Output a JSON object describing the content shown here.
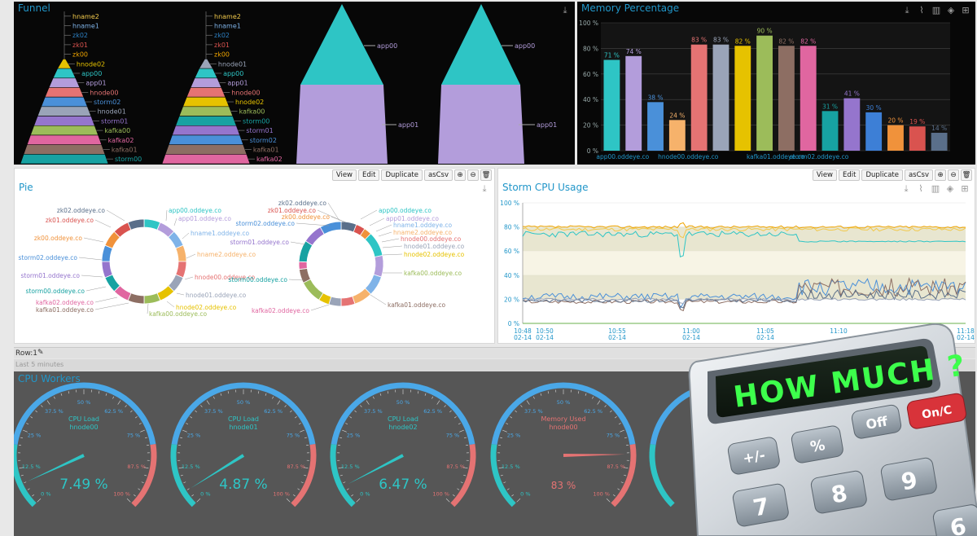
{
  "funnel_panel": {
    "title": "Funnel",
    "funnel_left": {
      "items": [
        {
          "label": "hname2",
          "color": "#f2c94c"
        },
        {
          "label": "hname1",
          "color": "#7fb3e8"
        },
        {
          "label": "zk02",
          "color": "#2d7fc1"
        },
        {
          "label": "zk01",
          "color": "#d9534f"
        },
        {
          "label": "zk00",
          "color": "#f0a500"
        },
        {
          "label": "hnode02",
          "color": "#e6c200"
        },
        {
          "label": "app00",
          "color": "#2ec5c5"
        },
        {
          "label": "app01",
          "color": "#b39ddb"
        },
        {
          "label": "hnode00",
          "color": "#e57373"
        },
        {
          "label": "storm02",
          "color": "#4a90d9"
        },
        {
          "label": "hnode01",
          "color": "#9aa4b8"
        },
        {
          "label": "storm01",
          "color": "#9575cd"
        },
        {
          "label": "kafka00",
          "color": "#9cbc5a"
        },
        {
          "label": "kafka02",
          "color": "#e066a0"
        },
        {
          "label": "kafka01",
          "color": "#8d6e63"
        },
        {
          "label": "storm00",
          "color": "#17a2a2"
        }
      ]
    },
    "funnel_right": {
      "items": [
        {
          "label": "hname2",
          "color": "#f2c94c"
        },
        {
          "label": "hname1",
          "color": "#7fb3e8"
        },
        {
          "label": "zk02",
          "color": "#2d7fc1"
        },
        {
          "label": "zk01",
          "color": "#d9534f"
        },
        {
          "label": "zk00",
          "color": "#f0a500"
        },
        {
          "label": "hnode01",
          "color": "#9aa4b8"
        },
        {
          "label": "app00",
          "color": "#2ec5c5"
        },
        {
          "label": "app01",
          "color": "#b39ddb"
        },
        {
          "label": "hnode00",
          "color": "#e57373"
        },
        {
          "label": "hnode02",
          "color": "#e6c200"
        },
        {
          "label": "kafka00",
          "color": "#9cbc5a"
        },
        {
          "label": "storm00",
          "color": "#17a2a2"
        },
        {
          "label": "storm01",
          "color": "#9575cd"
        },
        {
          "label": "storm02",
          "color": "#4a90d9"
        },
        {
          "label": "kafka01",
          "color": "#8d6e63"
        },
        {
          "label": "kafka02",
          "color": "#e066a0"
        }
      ]
    },
    "pyramids": [
      {
        "top_label": "app00",
        "bottom_label": "app01"
      },
      {
        "top_label": "app00",
        "bottom_label": "app01"
      }
    ]
  },
  "memory_panel": {
    "title": "Memory Percentage",
    "chart_data": {
      "type": "bar",
      "title": "Memory Percentage",
      "yticks": [
        "100 %",
        "80 %",
        "60 %",
        "40 %",
        "20 %",
        "0 %"
      ],
      "ylim": [
        0,
        100
      ],
      "xticks": [
        "app00.oddeye.co",
        "hnode00.oddeye.co",
        "kafka01.oddeye.co",
        "storm02.oddeye.co"
      ],
      "values": [
        71,
        74,
        38,
        24,
        83,
        83,
        82,
        90,
        82,
        82,
        31,
        41,
        30,
        20,
        19,
        14
      ],
      "value_labels": [
        "71 %",
        "74 %",
        "38 %",
        "24 %",
        "83 %",
        "83 %",
        "82 %",
        "90 %",
        "82 %",
        "82 %",
        "31 %",
        "41 %",
        "30 %",
        "20 %",
        "19 %",
        "14 %"
      ],
      "colors": [
        "#2ec5c5",
        "#b39ddb",
        "#4a90d9",
        "#f6b26b",
        "#e57373",
        "#9aa4b8",
        "#e6c200",
        "#9cbc5a",
        "#8d6e63",
        "#e066a0",
        "#17a2a2",
        "#9575cd",
        "#3d7fd6",
        "#f0923b",
        "#d9534f",
        "#5a6f8a"
      ]
    }
  },
  "toolbar": {
    "view": "View",
    "edit": "Edit",
    "duplicate": "Duplicate",
    "ascsv": "asCsv"
  },
  "pie_panel": {
    "title": "Pie",
    "left_labels": [
      "app00.oddeye.co",
      "app01.oddeye.co",
      "hname1.oddeye.co",
      "hname2.oddeye.co",
      "hnode00.oddeye.co",
      "hnode01.oddeye.co",
      "hnode02.oddeye.co",
      "kafka00.oddeye.co",
      "kafka01.oddeye.co",
      "kafka02.oddeye.co",
      "storm00.oddeye.co",
      "storm01.oddeye.co",
      "storm02.oddeye.co",
      "zk00.oddeye.co",
      "zk01.oddeye.co",
      "zk02.oddeye.co"
    ],
    "right_labels": [
      "zk02.oddeye.co",
      "zk01.oddeye.co",
      "zk00.oddeye.co",
      "storm02.oddeye.co",
      "storm01.oddeye.co",
      "storm00.oddeye.co",
      "app00.oddeye.co",
      "app01.oddeye.co",
      "hname1.oddeye.co",
      "hname2.oddeye.co",
      "hnode00.oddeye.co",
      "hnode01.oddeye.co",
      "hnode02.oddeye.co",
      "kafka00.oddeye.co",
      "kafka01.oddeye.co",
      "kafka02.oddeye.co"
    ]
  },
  "cpu_panel": {
    "title": "Storm CPU Usage",
    "chart_data": {
      "type": "line",
      "title": "Storm CPU Usage",
      "yticks": [
        "100 %",
        "80 %",
        "60 %",
        "40 %",
        "20 %",
        "0 %"
      ],
      "ylim": [
        0,
        100
      ],
      "xticks": [
        {
          "time": "10:48",
          "date": "02-14"
        },
        {
          "time": "10:50",
          "date": "02-14"
        },
        {
          "time": "10:55",
          "date": "02-14"
        },
        {
          "time": "11:00",
          "date": "02-14"
        },
        {
          "time": "11:05",
          "date": "02-14"
        },
        {
          "time": "11:10",
          "date": ""
        },
        {
          "time": "11:18",
          "date": "02-14"
        }
      ],
      "series_colors": [
        "#f2c94c",
        "#2ec5c5",
        "#f0a500",
        "#4a90d9",
        "#8d6e63",
        "#5a6f8a",
        "#9aa4b8"
      ]
    }
  },
  "row": {
    "label": "Row:1",
    "subtitle": "Last 5 minutes"
  },
  "gauges_panel": {
    "title": "CPU Workers",
    "ticks": [
      "0 %",
      "12.5 %",
      "25 %",
      "37.5 %",
      "50 %",
      "62.5 %",
      "75 %",
      "87.5 %",
      "100 %"
    ],
    "gauges": [
      {
        "name": "CPU Load",
        "host": "hnode00",
        "value": 7.49,
        "display": "7.49 %"
      },
      {
        "name": "CPU Load",
        "host": "hnode01",
        "value": 4.87,
        "display": "4.87 %"
      },
      {
        "name": "CPU Load",
        "host": "hnode02",
        "value": 6.47,
        "display": "6.47 %"
      },
      {
        "name": "Memory Used",
        "host": "hnode00",
        "value": 83,
        "display": "83 %"
      }
    ]
  },
  "calculator": {
    "display": "HOW MUCH ?",
    "keys": [
      "Off",
      "On/C",
      "+/-",
      "%",
      "7",
      "8",
      "9",
      "6"
    ]
  }
}
